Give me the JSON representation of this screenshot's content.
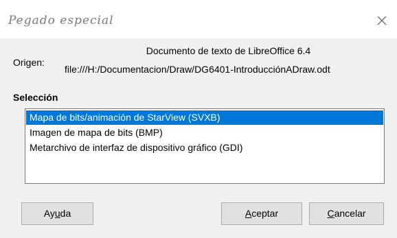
{
  "dialog": {
    "title": "Pegado especial",
    "close_icon": "close-icon"
  },
  "origin": {
    "label": "Origen:",
    "line1": "Documento de texto de LibreOffice 6.4",
    "line2": "file:///H:/Documentacion/Draw/DG6401-IntroducciónADraw.odt"
  },
  "selection": {
    "heading": "Selección",
    "items": [
      {
        "label": "Mapa de bits/animación de StarView (SVXB)",
        "selected": true
      },
      {
        "label": "Imagen de mapa de bits (BMP)",
        "selected": false
      },
      {
        "label": "Metarchivo de interfaz de dispositivo gráfico (GDI)",
        "selected": false
      }
    ]
  },
  "buttons": {
    "help": {
      "pre": "Ay",
      "mnemonic": "u",
      "post": "da"
    },
    "ok": {
      "pre": "",
      "mnemonic": "A",
      "post": "ceptar"
    },
    "cancel": {
      "pre": "",
      "mnemonic": "C",
      "post": "ancelar"
    }
  },
  "colors": {
    "selection_bg": "#0078d7",
    "dialog_bg": "#f0f0f0",
    "button_bg": "#e1e1e1"
  }
}
